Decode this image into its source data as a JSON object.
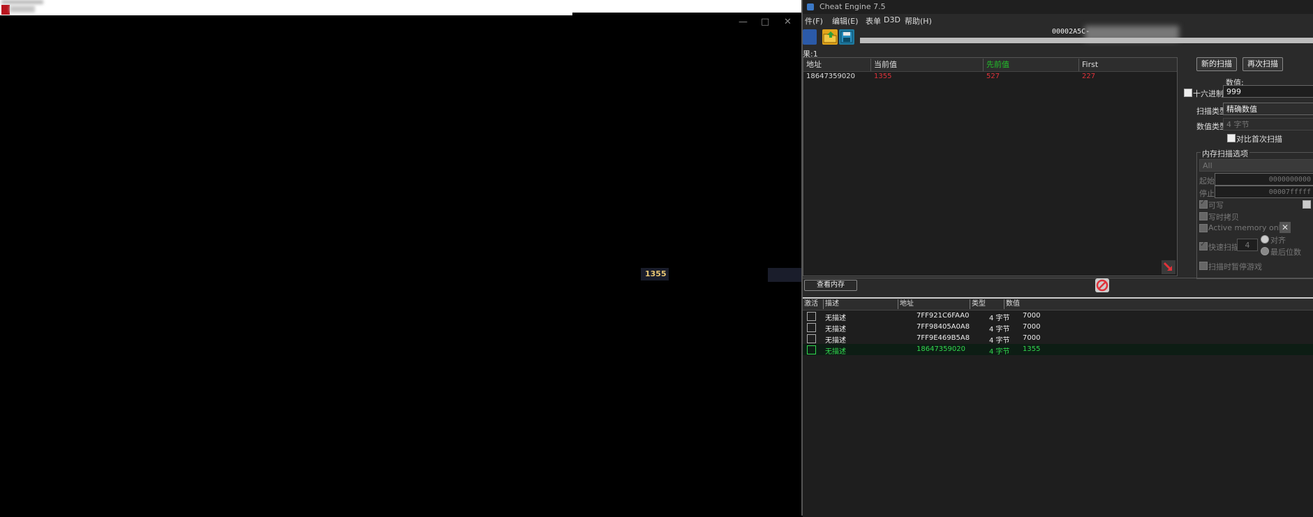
{
  "game": {
    "overlay_text": "1355",
    "close_glyph": "✕",
    "min_glyph": "—",
    "max_glyph": "□"
  },
  "ce": {
    "title": "Cheat Engine 7.5",
    "menu": [
      "件(F)",
      "编辑(E)",
      "表单",
      "D3D",
      "帮助(H)"
    ],
    "process_title": "00002A5C-",
    "found_label": "果:1",
    "results": {
      "headers": [
        "地址",
        "当前值",
        "先前值",
        "First"
      ],
      "header_colors": [
        "#dddddd",
        "#dddddd",
        "#22c02a",
        "#dddddd"
      ],
      "rows": [
        {
          "address": "18647359020",
          "current": "1355",
          "previous": "527",
          "first": "227"
        }
      ]
    },
    "scan": {
      "new_scan": "新的扫描",
      "next_scan": "再次扫描",
      "value_label": "数值:",
      "hex_label": "十六进制",
      "value": "999",
      "scan_type_label": "扫描类型",
      "scan_type": "精确数值",
      "value_type_label": "数值类型",
      "value_type": "4 字节",
      "compare_first": "对比首次扫描",
      "mem_options": "内存扫描选项",
      "region": "All",
      "start_label": "起始",
      "start_value": "0000000000",
      "stop_label": "停止",
      "stop_value": "00007fffff",
      "writable": "可写",
      "copy_on_write": "写时拷贝",
      "active_memory": "Active memory only",
      "fast_scan": "快速扫描",
      "fast_scan_value": "4",
      "align": "对齐",
      "last_digits": "最后位数",
      "pause_game": "扫描时暂停游戏"
    },
    "view_memory": "查看内存",
    "address_list": {
      "headers": [
        "激活",
        "描述",
        "地址",
        "类型",
        "数值"
      ],
      "rows": [
        {
          "desc": "无描述",
          "address": "7FF921C6FAA0",
          "type": "4 字节",
          "value": "7000"
        },
        {
          "desc": "无描述",
          "address": "7FF98405A0A8",
          "type": "4 字节",
          "value": "7000"
        },
        {
          "desc": "无描述",
          "address": "7FF9E469B5A8",
          "type": "4 字节",
          "value": "7000"
        },
        {
          "desc": "无描述",
          "address": "18647359020",
          "type": "4 字节",
          "value": "1355"
        }
      ]
    },
    "colors": {
      "accent_red": "#e0323a",
      "accent_green": "#31d84e"
    }
  }
}
